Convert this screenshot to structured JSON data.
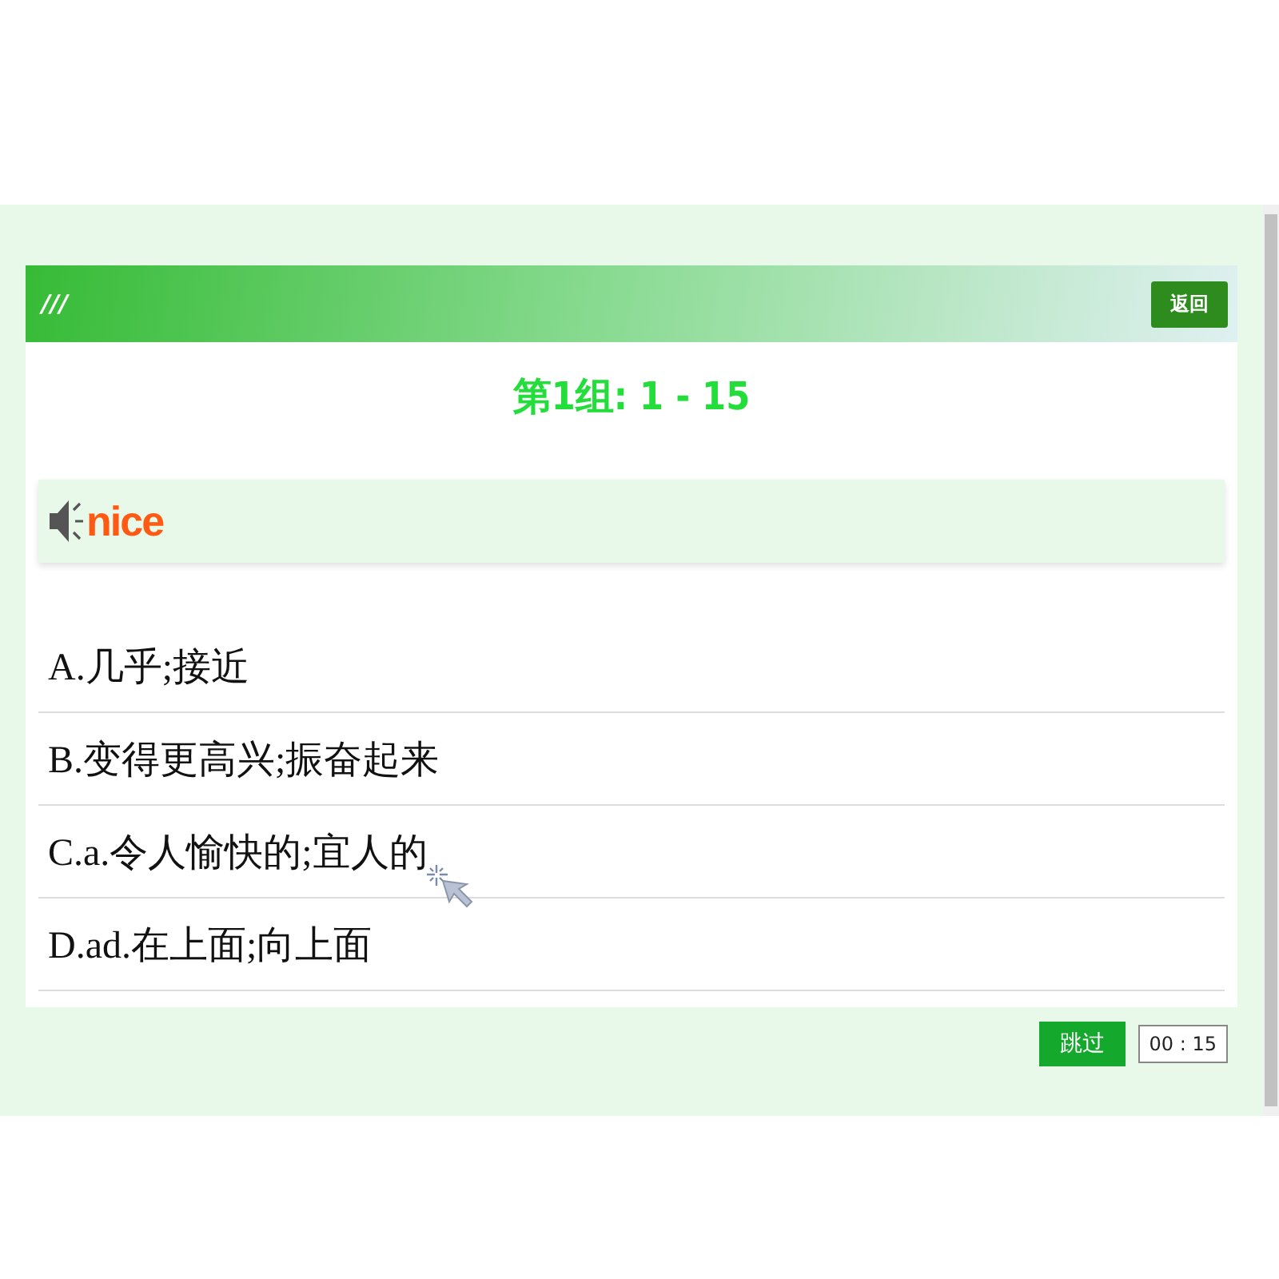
{
  "header": {
    "menu_mark": "///",
    "back_button": "返回"
  },
  "group_title": "第1组: 1 - 15",
  "word": "nice",
  "options": [
    {
      "text": "A.几乎;接近"
    },
    {
      "text": "B.变得更高兴;振奋起来"
    },
    {
      "text": "C.a.令人愉快的;宜人的"
    },
    {
      "text": "D.ad.在上面;向上面"
    }
  ],
  "footer": {
    "skip_button": "跳过",
    "timer": "00 : 15"
  }
}
